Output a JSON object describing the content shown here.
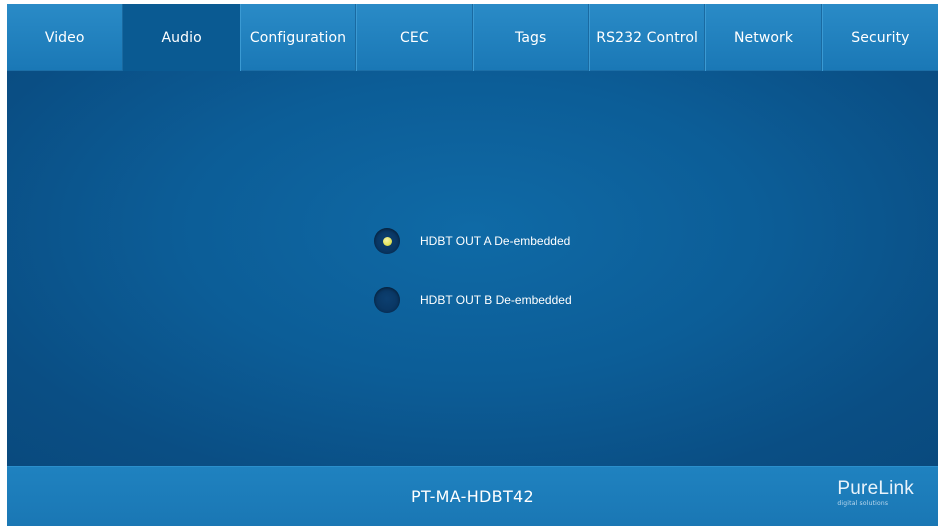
{
  "tabs": [
    {
      "label": "Video"
    },
    {
      "label": "Audio",
      "active": true
    },
    {
      "label": "Configuration"
    },
    {
      "label": "CEC"
    },
    {
      "label": "Tags"
    },
    {
      "label": "RS232 Control"
    },
    {
      "label": "Network"
    },
    {
      "label": "Security"
    }
  ],
  "audio": {
    "options": [
      {
        "label": "HDBT OUT A De-embedded",
        "selected": true
      },
      {
        "label": "HDBT OUT B De-embedded",
        "selected": false
      }
    ]
  },
  "footer": {
    "model": "PT-MA-HDBT42",
    "brand_name": "PureLink",
    "brand_tagline": "digital solutions"
  },
  "colors": {
    "tab_bar": "#2384c2",
    "active_tab": "#0a5a92",
    "background": "#0c5d97",
    "radio_selected_dot": "#e2e35a"
  }
}
